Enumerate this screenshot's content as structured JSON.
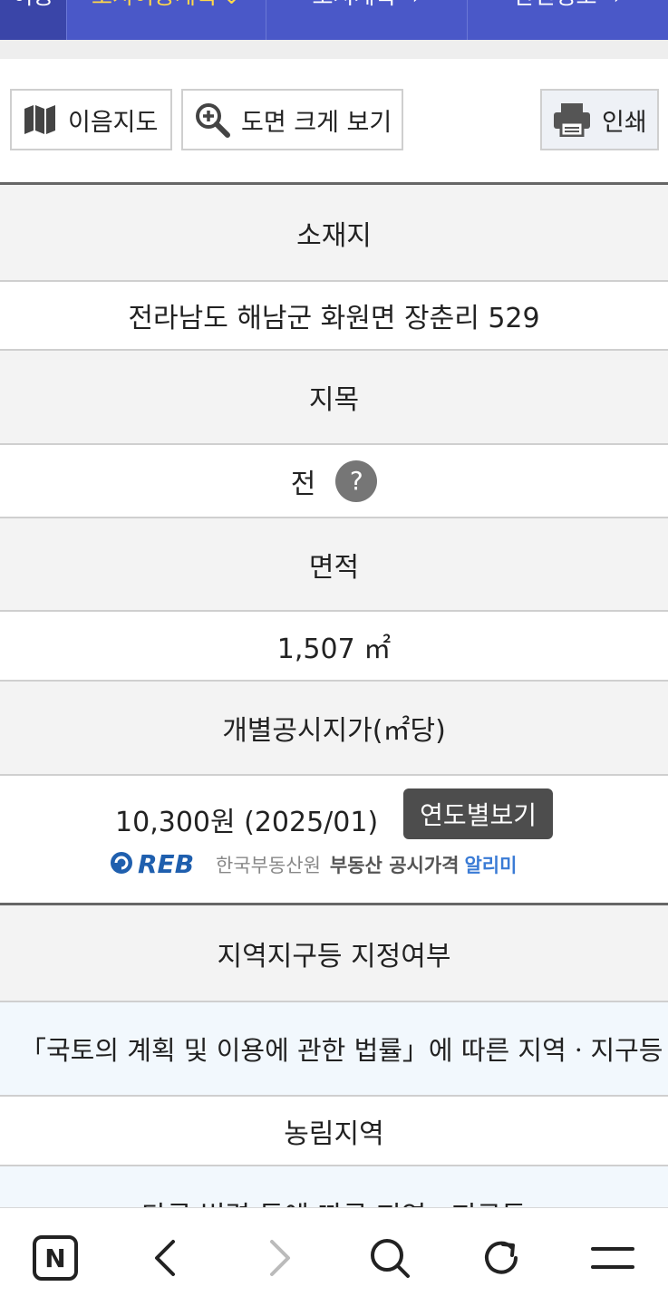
{
  "topnav": {
    "tabs": [
      {
        "label": "이동"
      },
      {
        "label": "토지이용계획"
      },
      {
        "label": "도시계획"
      },
      {
        "label": "관련정보"
      }
    ]
  },
  "toolbar": {
    "map_label": "이음지도",
    "zoom_label": "도면 크게 보기",
    "print_label": "인쇄"
  },
  "table": {
    "location_header": "소재지",
    "location_value": "전라남도 해남군 화원면 장춘리 529",
    "category_header": "지목",
    "category_value": "전",
    "help_symbol": "?",
    "area_header": "면적",
    "area_value": "1,507 ㎡",
    "price_header": "개별공시지가(㎡당)",
    "price_value": "10,300원 (2025/01)",
    "year_button": "연도별보기",
    "reb": {
      "logo": "REB",
      "org": "한국부동산원",
      "service": "부동산 공시가격",
      "service_accent": "알리미"
    },
    "zone_header": "지역지구등 지정여부",
    "law_text": "「국토의 계획 및 이용에 관한 법률」에 따른 지역ㆍ지구등",
    "zone_value": "농림지역",
    "other_law_text": "다른 법령 등에 따른 지역ㆍ지구등"
  },
  "bottombar": {
    "icons": [
      "naver-home-icon",
      "back-icon",
      "forward-icon",
      "search-icon",
      "refresh-icon",
      "menu-icon"
    ],
    "n_letter": "N"
  },
  "colors": {
    "nav_bg": "#4a58c8",
    "nav_active_text": "#ffd84a",
    "year_button_bg": "#4d4d4d",
    "reb_accent": "#3a7bd5"
  }
}
